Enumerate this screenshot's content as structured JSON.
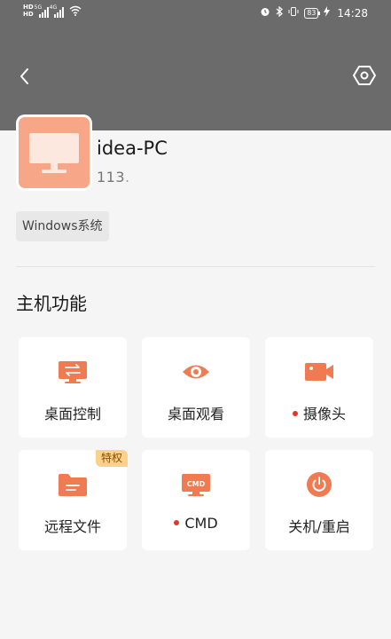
{
  "status_bar": {
    "hd1": "HD",
    "hd2": "HD",
    "sig1_tag": "5G",
    "sig2_tag": "4G",
    "battery": "83",
    "time": "14:28",
    "icons": [
      "alarm-icon",
      "bluetooth-icon",
      "vibrate-icon",
      "battery-icon",
      "charging-icon",
      "wifi-icon",
      "signal-icon"
    ]
  },
  "header": {
    "back_icon": "chevron-left-icon",
    "settings_icon": "hexagon-settings-icon"
  },
  "device": {
    "name": "idea-PC",
    "ip": "113.",
    "os_tag": "Windows系统",
    "avatar_icon": "monitor-icon"
  },
  "section": {
    "title": "主机功能"
  },
  "functions": [
    {
      "label": "桌面控制",
      "icon": "remote-control-icon",
      "dot": false,
      "badge": ""
    },
    {
      "label": "桌面观看",
      "icon": "eye-icon",
      "dot": false,
      "badge": ""
    },
    {
      "label": "摄像头",
      "icon": "camera-icon",
      "dot": true,
      "badge": ""
    },
    {
      "label": "远程文件",
      "icon": "folder-icon",
      "dot": false,
      "badge": "特权"
    },
    {
      "label": "CMD",
      "icon": "cmd-icon",
      "dot": true,
      "badge": ""
    },
    {
      "label": "关机/重启",
      "icon": "power-icon",
      "dot": false,
      "badge": ""
    }
  ],
  "colors": {
    "accent": "#f07a52",
    "header_bg": "#6b6b6b",
    "avatar_bg": "#f7a787",
    "badge_bg": "#fbd28a",
    "dot": "#e0392b"
  }
}
